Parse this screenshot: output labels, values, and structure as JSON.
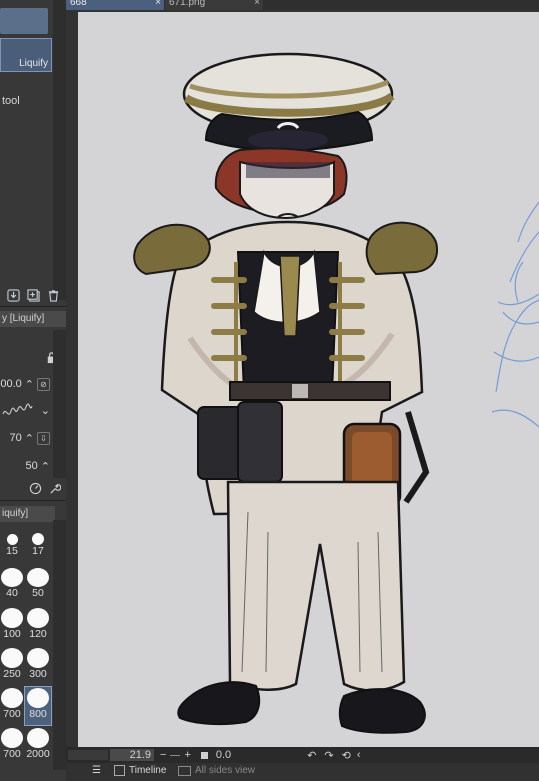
{
  "tabs": [
    {
      "label": "668",
      "close": "×"
    },
    {
      "label": "671.png",
      "close": "×"
    }
  ],
  "subtool": {
    "active_item": "Liquify",
    "group_label": "tool"
  },
  "tool_property": {
    "tab_title": "y [Liquify]",
    "opacity_value": "00.0",
    "strength_value": "70",
    "hardness_value": "50"
  },
  "brush_size": {
    "tab_title": "iquify]",
    "sizes": [
      "15",
      "17",
      "40",
      "50",
      "100",
      "120",
      "250",
      "300",
      "700",
      "800",
      "700",
      "2000"
    ],
    "selected": "800"
  },
  "navigator": {
    "zoom": "21.9",
    "minus": "−",
    "plus": "+",
    "angle": "0.0"
  },
  "status": {
    "timeline_label": "Timeline",
    "all_sides_label": "All sides view"
  }
}
